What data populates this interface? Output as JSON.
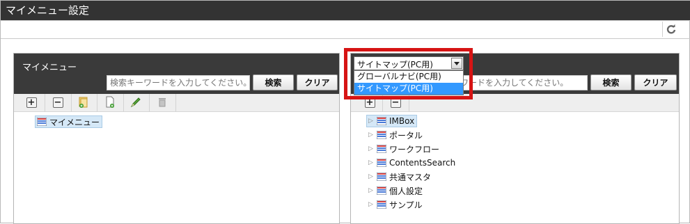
{
  "window": {
    "title": "マイメニュー設定"
  },
  "toolbar": {
    "refresh_icon": "refresh-icon"
  },
  "left_panel": {
    "title": "マイメニュー",
    "search_placeholder": "検索キーワードを入力してください。",
    "search_label": "検索",
    "clear_label": "クリア",
    "tools": [
      "add-icon",
      "remove-icon",
      "add-folder-icon",
      "add-page-icon",
      "edit-icon",
      "delete-icon"
    ],
    "tree": [
      {
        "label": "マイメニュー",
        "selected": true
      }
    ]
  },
  "right_panel": {
    "site_select": {
      "value": "サイトマップ(PC用)",
      "options": [
        "グローバルナビ(PC用)",
        "サイトマップ(PC用)"
      ],
      "selected_index": 1
    },
    "search_placeholder": "キーワードを入力してください。",
    "search_label": "検索",
    "clear_label": "クリア",
    "tree": [
      {
        "label": "IMBox",
        "selected": true
      },
      {
        "label": "ポータル"
      },
      {
        "label": "ワークフロー"
      },
      {
        "label": "ContentsSearch"
      },
      {
        "label": "共通マスタ"
      },
      {
        "label": "個人設定"
      },
      {
        "label": "サンプル"
      }
    ]
  },
  "colors": {
    "highlight": "#d61414",
    "selection": "#3399ff"
  }
}
